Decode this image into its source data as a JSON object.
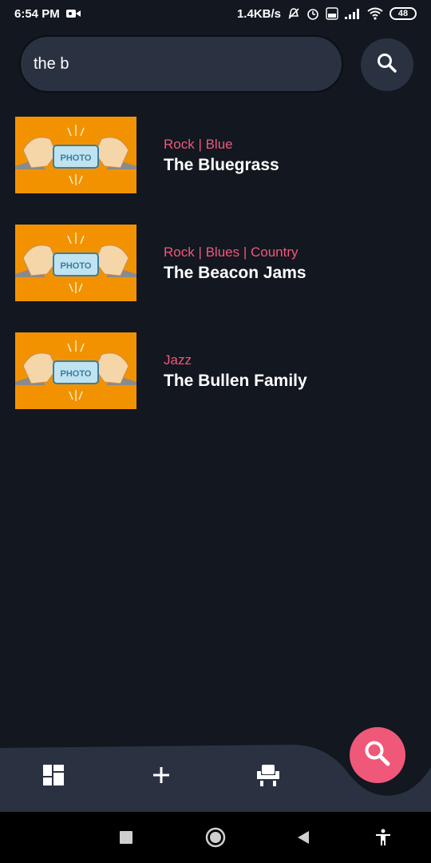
{
  "status_bar": {
    "time": "6:54 PM",
    "network_speed": "1.4KB/s",
    "battery": "48",
    "icons": [
      "video-camera-icon",
      "mute-icon",
      "alarm-icon",
      "volte-icon",
      "signal-icon",
      "wifi-icon",
      "battery-icon"
    ]
  },
  "search": {
    "value": "the b",
    "button_icon": "search-icon"
  },
  "results": [
    {
      "genre": "Rock | Blue",
      "title": "The Bluegrass",
      "thumbnail": "PHOTO"
    },
    {
      "genre": "Rock | Blues | Country",
      "title": "The Beacon Jams",
      "thumbnail": "PHOTO"
    },
    {
      "genre": "Jazz",
      "title": "The Bullen Family",
      "thumbnail": "PHOTO"
    }
  ],
  "bottom_nav": {
    "items": [
      "dashboard-icon",
      "add-icon",
      "seat-icon"
    ],
    "fab_icon": "search-icon"
  },
  "system_nav": [
    "recents-icon",
    "home-icon",
    "back-icon",
    "accessibility-icon"
  ],
  "colors": {
    "background": "#121720",
    "surface": "#2a3242",
    "accent": "#f0587a",
    "thumbnail": "#f39200"
  }
}
